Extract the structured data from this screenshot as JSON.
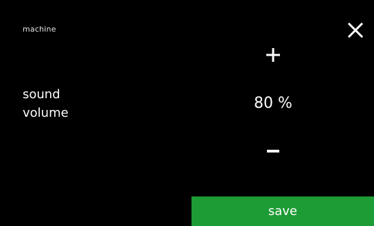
{
  "header": {
    "breadcrumb": "machine",
    "close_icon": "close-icon"
  },
  "setting": {
    "label_line1": "sound",
    "label_line2": "volume",
    "value": "80 %",
    "increase_icon": "plus-icon",
    "decrease_icon": "minus-icon"
  },
  "footer": {
    "save_label": "save"
  },
  "colors": {
    "background": "#000000",
    "text": "#ffffff",
    "save_button": "#1d9b35"
  }
}
